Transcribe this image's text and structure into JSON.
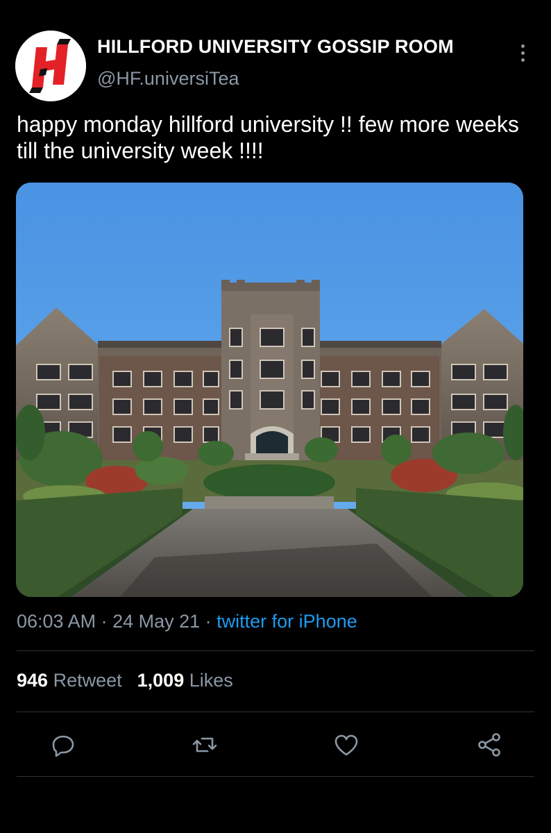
{
  "account": {
    "display_name": "HILLFORD UNIVERSITY GOSSIP ROOM",
    "handle": "@HF.universiTea",
    "avatar_icon": "hillford-h-logo"
  },
  "tweet": {
    "text": "happy monday hillford university !! few more weeks till the university week !!!!",
    "image_alt_icon": "university-building-photo"
  },
  "meta": {
    "time": "06:03 AM",
    "separator1": " · ",
    "date": "24 May 21",
    "separator2": " · ",
    "source": "twitter for iPhone"
  },
  "stats": {
    "retweets_count": "946",
    "retweets_label": "Retweet",
    "likes_count": "1,009",
    "likes_label": "Likes"
  },
  "actions": [
    "reply-icon",
    "retweet-icon",
    "like-icon",
    "share-icon"
  ],
  "colors": {
    "background": "#000000",
    "secondary_text": "#8b98a5",
    "link": "#1d9bf0",
    "avatar_red": "#e32227"
  }
}
